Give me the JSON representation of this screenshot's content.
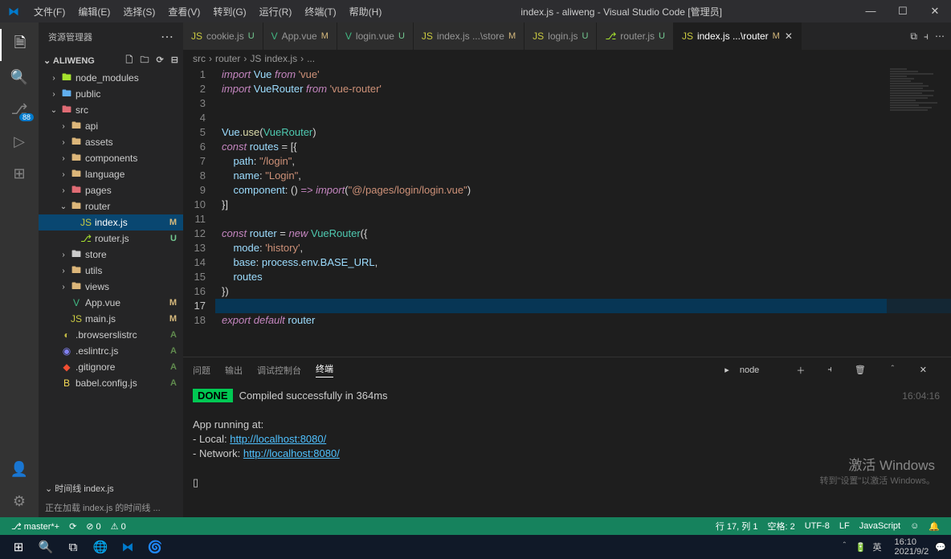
{
  "titlebar": {
    "title": "index.js - aliweng - Visual Studio Code [管理员]",
    "menus": [
      "文件(F)",
      "编辑(E)",
      "选择(S)",
      "查看(V)",
      "转到(G)",
      "运行(R)",
      "终端(T)",
      "帮助(H)"
    ]
  },
  "activity": {
    "scm_badge": "88"
  },
  "sidebar": {
    "title": "资源管理器",
    "folder": "ALIWENG",
    "tree": [
      {
        "d": 1,
        "t": "folder",
        "name": "node_modules",
        "chev": "›",
        "color": "folder-green"
      },
      {
        "d": 1,
        "t": "folder",
        "name": "public",
        "chev": "›",
        "color": "folder-blue"
      },
      {
        "d": 1,
        "t": "folder",
        "name": "src",
        "chev": "⌄",
        "color": "folder-red"
      },
      {
        "d": 2,
        "t": "folder",
        "name": "api",
        "chev": "›",
        "color": "folder-yellow"
      },
      {
        "d": 2,
        "t": "folder",
        "name": "assets",
        "chev": "›",
        "color": "folder-yellow"
      },
      {
        "d": 2,
        "t": "folder",
        "name": "components",
        "chev": "›",
        "color": "folder-yellow"
      },
      {
        "d": 2,
        "t": "folder",
        "name": "language",
        "chev": "›",
        "color": "folder-yellow"
      },
      {
        "d": 2,
        "t": "folder",
        "name": "pages",
        "chev": "›",
        "color": "folder-red"
      },
      {
        "d": 2,
        "t": "folder",
        "name": "router",
        "chev": "⌄",
        "color": "folder-yellow"
      },
      {
        "d": 3,
        "t": "file",
        "name": "index.js",
        "icon": "JS",
        "iconClass": "icon-js",
        "status": "M",
        "selected": true
      },
      {
        "d": 3,
        "t": "file",
        "name": "router.js",
        "icon": "⎇",
        "iconClass": "folder-green",
        "status": "U"
      },
      {
        "d": 2,
        "t": "folder",
        "name": "store",
        "chev": "›",
        "color": ""
      },
      {
        "d": 2,
        "t": "folder",
        "name": "utils",
        "chev": "›",
        "color": "folder-yellow"
      },
      {
        "d": 2,
        "t": "folder",
        "name": "views",
        "chev": "›",
        "color": "folder-yellow"
      },
      {
        "d": 2,
        "t": "file",
        "name": "App.vue",
        "icon": "V",
        "iconClass": "icon-vue",
        "status": "M"
      },
      {
        "d": 2,
        "t": "file",
        "name": "main.js",
        "icon": "JS",
        "iconClass": "icon-js",
        "status": "M"
      },
      {
        "d": 1,
        "t": "file",
        "name": ".browserslistrc",
        "icon": "◐",
        "iconClass": "icon-config",
        "status": "A"
      },
      {
        "d": 1,
        "t": "file",
        "name": ".eslintrc.js",
        "icon": "◉",
        "iconClass": "icon-eslint",
        "status": "A"
      },
      {
        "d": 1,
        "t": "file",
        "name": ".gitignore",
        "icon": "◆",
        "iconClass": "icon-git",
        "status": "A"
      },
      {
        "d": 1,
        "t": "file",
        "name": "babel.config.js",
        "icon": "B",
        "iconClass": "icon-babel",
        "status": "A"
      }
    ],
    "timeline_label": "时间线  index.js",
    "timeline_msg": "正在加载 index.js 的时间线 ..."
  },
  "tabs": [
    {
      "icon": "JS",
      "iconClass": "icon-js",
      "label": "cookie.js",
      "status": "U",
      "statusClass": "U"
    },
    {
      "icon": "V",
      "iconClass": "icon-vue",
      "label": "App.vue",
      "status": "M",
      "statusClass": "M"
    },
    {
      "icon": "V",
      "iconClass": "icon-vue",
      "label": "login.vue",
      "status": "U",
      "statusClass": "U"
    },
    {
      "icon": "JS",
      "iconClass": "icon-js",
      "label": "index.js ...\\store",
      "status": "M",
      "statusClass": "M"
    },
    {
      "icon": "JS",
      "iconClass": "icon-js",
      "label": "login.js",
      "status": "U",
      "statusClass": "U"
    },
    {
      "icon": "⎇",
      "iconClass": "folder-green",
      "label": "router.js",
      "status": "U",
      "statusClass": "U"
    },
    {
      "icon": "JS",
      "iconClass": "icon-js",
      "label": "index.js ...\\router",
      "status": "M",
      "statusClass": "M",
      "active": true,
      "close": true
    }
  ],
  "breadcrumb": [
    "src",
    "›",
    "router",
    "›",
    "JS",
    "index.js",
    "›",
    "..."
  ],
  "code": {
    "lines": [
      [
        {
          "c": "c-keyword",
          "t": "import"
        },
        {
          "t": " "
        },
        {
          "c": "c-var",
          "t": "Vue"
        },
        {
          "t": " "
        },
        {
          "c": "c-keyword",
          "t": "from"
        },
        {
          "t": " "
        },
        {
          "c": "c-string",
          "t": "'vue'"
        }
      ],
      [
        {
          "c": "c-keyword",
          "t": "import"
        },
        {
          "t": " "
        },
        {
          "c": "c-var",
          "t": "VueRouter"
        },
        {
          "t": " "
        },
        {
          "c": "c-keyword",
          "t": "from"
        },
        {
          "t": " "
        },
        {
          "c": "c-string",
          "t": "'vue-router'"
        }
      ],
      [],
      [],
      [
        {
          "c": "c-var",
          "t": "Vue"
        },
        {
          "c": "c-punct",
          "t": "."
        },
        {
          "c": "c-func",
          "t": "use"
        },
        {
          "c": "c-punct",
          "t": "("
        },
        {
          "c": "c-class",
          "t": "VueRouter"
        },
        {
          "c": "c-punct",
          "t": ")"
        }
      ],
      [
        {
          "c": "c-keyword",
          "t": "const"
        },
        {
          "t": " "
        },
        {
          "c": "c-var",
          "t": "routes"
        },
        {
          "t": " "
        },
        {
          "c": "c-operator",
          "t": "="
        },
        {
          "t": " "
        },
        {
          "c": "c-punct",
          "t": "[{"
        }
      ],
      [
        {
          "t": "    "
        },
        {
          "c": "c-var",
          "t": "path"
        },
        {
          "c": "c-punct",
          "t": ": "
        },
        {
          "c": "c-string",
          "t": "\"/login\""
        },
        {
          "c": "c-punct",
          "t": ","
        }
      ],
      [
        {
          "t": "    "
        },
        {
          "c": "c-var",
          "t": "name"
        },
        {
          "c": "c-punct",
          "t": ": "
        },
        {
          "c": "c-string",
          "t": "\"Login\""
        },
        {
          "c": "c-punct",
          "t": ","
        }
      ],
      [
        {
          "t": "    "
        },
        {
          "c": "c-var",
          "t": "component"
        },
        {
          "c": "c-punct",
          "t": ": () "
        },
        {
          "c": "c-keyword",
          "t": "=>"
        },
        {
          "t": " "
        },
        {
          "c": "c-keyword",
          "t": "import"
        },
        {
          "c": "c-punct",
          "t": "("
        },
        {
          "c": "c-string",
          "t": "\"@/pages/login/login.vue\""
        },
        {
          "c": "c-punct",
          "t": ")"
        }
      ],
      [
        {
          "c": "c-punct",
          "t": "}]"
        }
      ],
      [],
      [
        {
          "c": "c-keyword",
          "t": "const"
        },
        {
          "t": " "
        },
        {
          "c": "c-var",
          "t": "router"
        },
        {
          "t": " "
        },
        {
          "c": "c-operator",
          "t": "="
        },
        {
          "t": " "
        },
        {
          "c": "c-keyword",
          "t": "new"
        },
        {
          "t": " "
        },
        {
          "c": "c-class",
          "t": "VueRouter"
        },
        {
          "c": "c-punct",
          "t": "({"
        }
      ],
      [
        {
          "t": "    "
        },
        {
          "c": "c-var",
          "t": "mode"
        },
        {
          "c": "c-punct",
          "t": ": "
        },
        {
          "c": "c-string",
          "t": "'history'"
        },
        {
          "c": "c-punct",
          "t": ","
        }
      ],
      [
        {
          "t": "    "
        },
        {
          "c": "c-var",
          "t": "base"
        },
        {
          "c": "c-punct",
          "t": ": "
        },
        {
          "c": "c-var",
          "t": "process"
        },
        {
          "c": "c-punct",
          "t": "."
        },
        {
          "c": "c-var",
          "t": "env"
        },
        {
          "c": "c-punct",
          "t": "."
        },
        {
          "c": "c-var",
          "t": "BASE_URL"
        },
        {
          "c": "c-punct",
          "t": ","
        }
      ],
      [
        {
          "t": "    "
        },
        {
          "c": "c-var",
          "t": "routes"
        }
      ],
      [
        {
          "c": "c-punct",
          "t": "})"
        }
      ],
      [],
      [
        {
          "c": "c-keyword",
          "t": "export default"
        },
        {
          "t": " "
        },
        {
          "c": "c-var",
          "t": "router"
        }
      ]
    ],
    "highlighted_line": 17
  },
  "panel": {
    "tabs": [
      "问题",
      "输出",
      "调试控制台",
      "终端"
    ],
    "active_tab": 3,
    "shell": "node",
    "done_label": "DONE",
    "done_msg": "Compiled successfully in 364ms",
    "time": "16:04:16",
    "running": "App running at:",
    "local_label": "- Local:   ",
    "local_url": "http://localhost:8080/",
    "network_label": "- Network: ",
    "network_url": "http://localhost:8080/"
  },
  "statusbar": {
    "branch": "master*+",
    "sync": "⟳",
    "errors": "⊘ 0",
    "warnings": "⚠ 0",
    "line_col": "行 17, 列 1",
    "spaces": "空格: 2",
    "encoding": "UTF-8",
    "eol": "LF",
    "lang": "JavaScript"
  },
  "watermark": {
    "big": "激活 Windows",
    "small": "转到\"设置\"以激活 Windows。"
  },
  "taskbar": {
    "time": "16:10",
    "date": "2021/9/2"
  }
}
